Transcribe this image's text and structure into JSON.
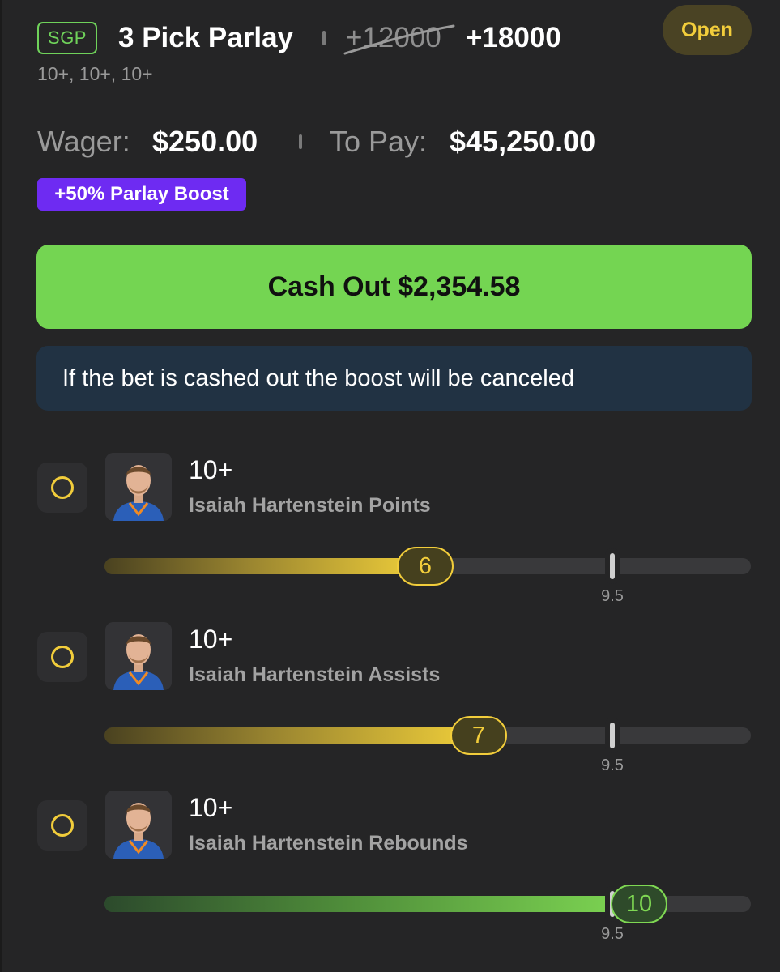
{
  "header": {
    "badge": "SGP",
    "title": "3 Pick Parlay",
    "old_odds": "+12000",
    "new_odds": "+18000",
    "status": "Open",
    "subtitle": "10+, 10+, 10+"
  },
  "summary": {
    "wager_label": "Wager:",
    "wager_value": "$250.00",
    "topay_label": "To Pay:",
    "topay_value": "$45,250.00",
    "boost_label": "+50% Parlay Boost"
  },
  "cashout": {
    "label": "Cash Out $2,354.58"
  },
  "notice": {
    "text": "If the bet is cashed out the boost will be canceled"
  },
  "colors": {
    "accent_green": "#74d552",
    "accent_yellow": "#f2cd3b",
    "boost_purple": "#6e2bf2",
    "notice_bg": "#213243"
  },
  "legs": [
    {
      "line": "10+",
      "market": "Isaiah Hartenstein Points",
      "current": "6",
      "current_value": 6,
      "target_label": "9.5",
      "target_value": 9.5,
      "state": "in-progress"
    },
    {
      "line": "10+",
      "market": "Isaiah Hartenstein Assists",
      "current": "7",
      "current_value": 7,
      "target_label": "9.5",
      "target_value": 9.5,
      "state": "in-progress"
    },
    {
      "line": "10+",
      "market": "Isaiah Hartenstein Rebounds",
      "current": "10",
      "current_value": 10,
      "target_label": "9.5",
      "target_value": 9.5,
      "state": "hit"
    }
  ]
}
